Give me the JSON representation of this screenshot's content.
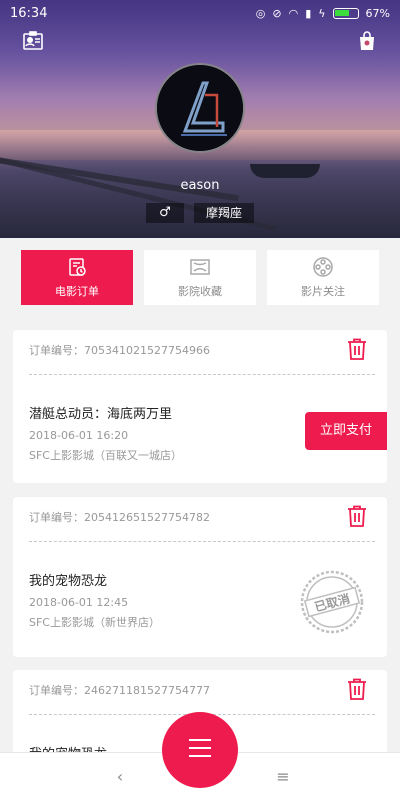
{
  "status_bar": {
    "time": "16:34",
    "battery": "67%"
  },
  "profile": {
    "name": "eason",
    "gender_symbol": "♂",
    "zodiac": "摩羯座"
  },
  "tabs": [
    {
      "label": "电影订单",
      "active": true
    },
    {
      "label": "影院收藏",
      "active": false
    },
    {
      "label": "影片关注",
      "active": false
    }
  ],
  "orders": [
    {
      "order_no_label": "订单编号：705341021527754966",
      "movie": "潜艇总动员：海底两万里",
      "time": "2018-06-01 16:20",
      "cinema": "SFC上影影城（百联又一城店）",
      "action": "立即支付"
    },
    {
      "order_no_label": "订单编号：205412651527754782",
      "movie": "我的宠物恐龙",
      "time": "2018-06-01 12:45",
      "cinema": "SFC上影影城（新世界店）",
      "stamp": "已取消"
    },
    {
      "order_no_label": "订单编号：246271181527754777",
      "movie": "我的宠物恐龙"
    }
  ],
  "nav": {
    "back": "‹",
    "home": "□",
    "menu": "≡"
  },
  "colors": {
    "accent": "#ee1c4e"
  }
}
